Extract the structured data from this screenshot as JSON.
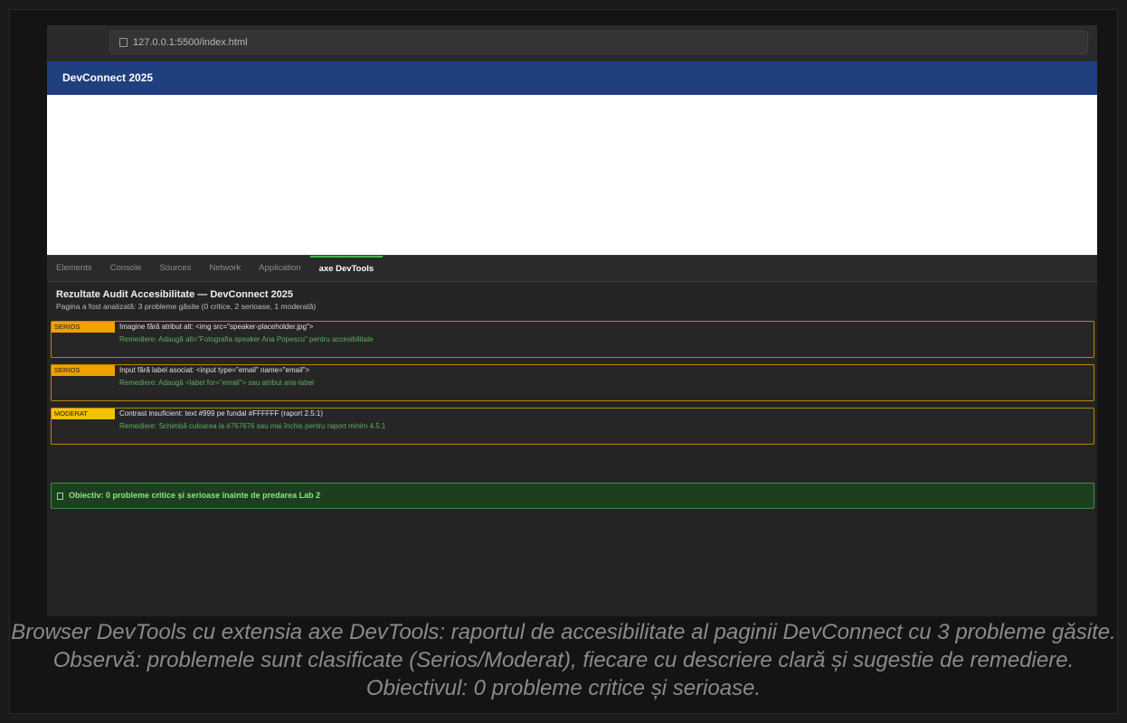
{
  "browser": {
    "url": "127.0.0.1:5500/index.html"
  },
  "site": {
    "title": "DevConnect 2025"
  },
  "devtools": {
    "tabs": [
      {
        "label": "Elements"
      },
      {
        "label": "Console"
      },
      {
        "label": "Sources"
      },
      {
        "label": "Network"
      },
      {
        "label": "Application"
      },
      {
        "label": "axe DevTools",
        "active": true
      }
    ],
    "title": "Rezultate Audit Accesibilitate — DevConnect 2025",
    "summary": "Pagina a fost analizată: 3 probleme găsite (0 critice, 2 serioase, 1 moderată)",
    "issues": [
      {
        "severity": "SERIOS",
        "description": "Imagine fără atribut alt: <img src=\"speaker-placeholder.jpg\">",
        "fix": "Remediere: Adaugă alt=\"Fotografia speaker Ana Popescu\" pentru accesibilitate"
      },
      {
        "severity": "SERIOS",
        "description": "Input fără label asociat: <input type=\"email\" name=\"email\">",
        "fix": "Remediere: Adaugă <label for=\"email\"> sau atribut aria-label"
      },
      {
        "severity": "MODERAT",
        "description": "Contrast insuficient: text #999 pe fundal #FFFFFF (raport 2.5:1)",
        "fix": "Remediere: Schimbă culoarea la #767676 sau mai închis pentru raport minim 4.5:1"
      }
    ],
    "goal": "Obiectiv: 0 probleme critice și serioase înainte de predarea Lab 2"
  },
  "caption": "Browser DevTools cu extensia axe DevTools: raportul de accesibilitate al paginii DevConnect cu 3 probleme găsite. Observă: problemele sunt clasificate (Serios/Moderat), fiecare cu descriere clară și sugestie de remediere. Obiectivul: 0 probleme critice și serioase.",
  "colors": {
    "header": "#1f3f7f",
    "serios": "#f0a000",
    "moderat": "#f2c200",
    "issue_border": "#b8860b",
    "fix_text": "#5fae5f",
    "goal_bg": "#1e3f1e",
    "active_tab": "#45b449"
  },
  "icons": {
    "url_page": "page-icon",
    "goal": "checkbox-icon"
  }
}
